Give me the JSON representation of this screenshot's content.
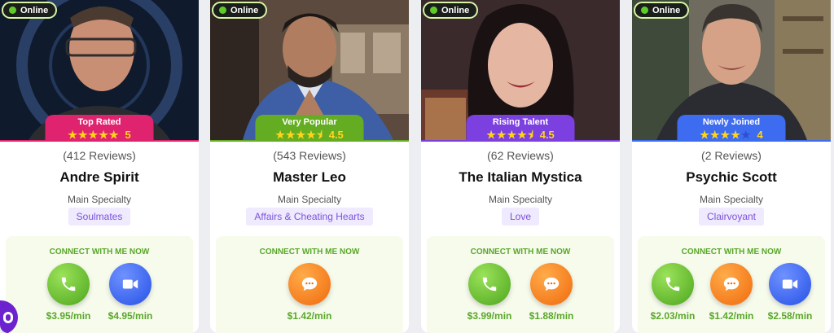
{
  "status_label": "Online",
  "connect_title": "CONNECT WITH ME NOW",
  "specialty_label": "Main Specialty",
  "colors": {
    "online_green": "#5fcb2a",
    "price_green": "#5aa72a",
    "star_yellow": "#ffd51c",
    "tag_bg": "#efeafd",
    "tag_text": "#7a52dc"
  },
  "advisors": [
    {
      "name": "Andre Spirit",
      "reviews": "(412 Reviews)",
      "specialty": "Soulmates",
      "badge": "Top Rated",
      "badge_color": "#e0236e",
      "rating": "5",
      "rating_value": 5,
      "actions": [
        {
          "type": "phone",
          "icon": "phone-icon",
          "color": "green",
          "price": "$3.95/min"
        },
        {
          "type": "video",
          "icon": "video-camera-icon",
          "color": "blue",
          "price": "$4.95/min"
        }
      ]
    },
    {
      "name": "Master Leo",
      "reviews": "(543 Reviews)",
      "specialty": "Affairs & Cheating Hearts",
      "badge": "Very Popular",
      "badge_color": "#64ad22",
      "rating": "4.5",
      "rating_value": 4.5,
      "actions": [
        {
          "type": "chat",
          "icon": "chat-bubble-icon",
          "color": "orange",
          "price": "$1.42/min"
        }
      ]
    },
    {
      "name": "The Italian Mystica",
      "reviews": "(62 Reviews)",
      "specialty": "Love",
      "badge": "Rising Talent",
      "badge_color": "#7c3fe0",
      "rating": "4.5",
      "rating_value": 4.5,
      "actions": [
        {
          "type": "phone",
          "icon": "phone-icon",
          "color": "green",
          "price": "$3.99/min"
        },
        {
          "type": "chat",
          "icon": "chat-bubble-icon",
          "color": "orange",
          "price": "$1.88/min"
        }
      ]
    },
    {
      "name": "Psychic Scott",
      "reviews": "(2 Reviews)",
      "specialty": "Clairvoyant",
      "badge": "Newly Joined",
      "badge_color": "#3d6cf0",
      "rating": "4",
      "rating_value": 4,
      "actions": [
        {
          "type": "phone",
          "icon": "phone-icon",
          "color": "green",
          "price": "$2.03/min"
        },
        {
          "type": "chat",
          "icon": "chat-bubble-icon",
          "color": "orange",
          "price": "$1.42/min"
        },
        {
          "type": "video",
          "icon": "video-camera-icon",
          "color": "blue",
          "price": "$2.58/min"
        }
      ]
    }
  ]
}
